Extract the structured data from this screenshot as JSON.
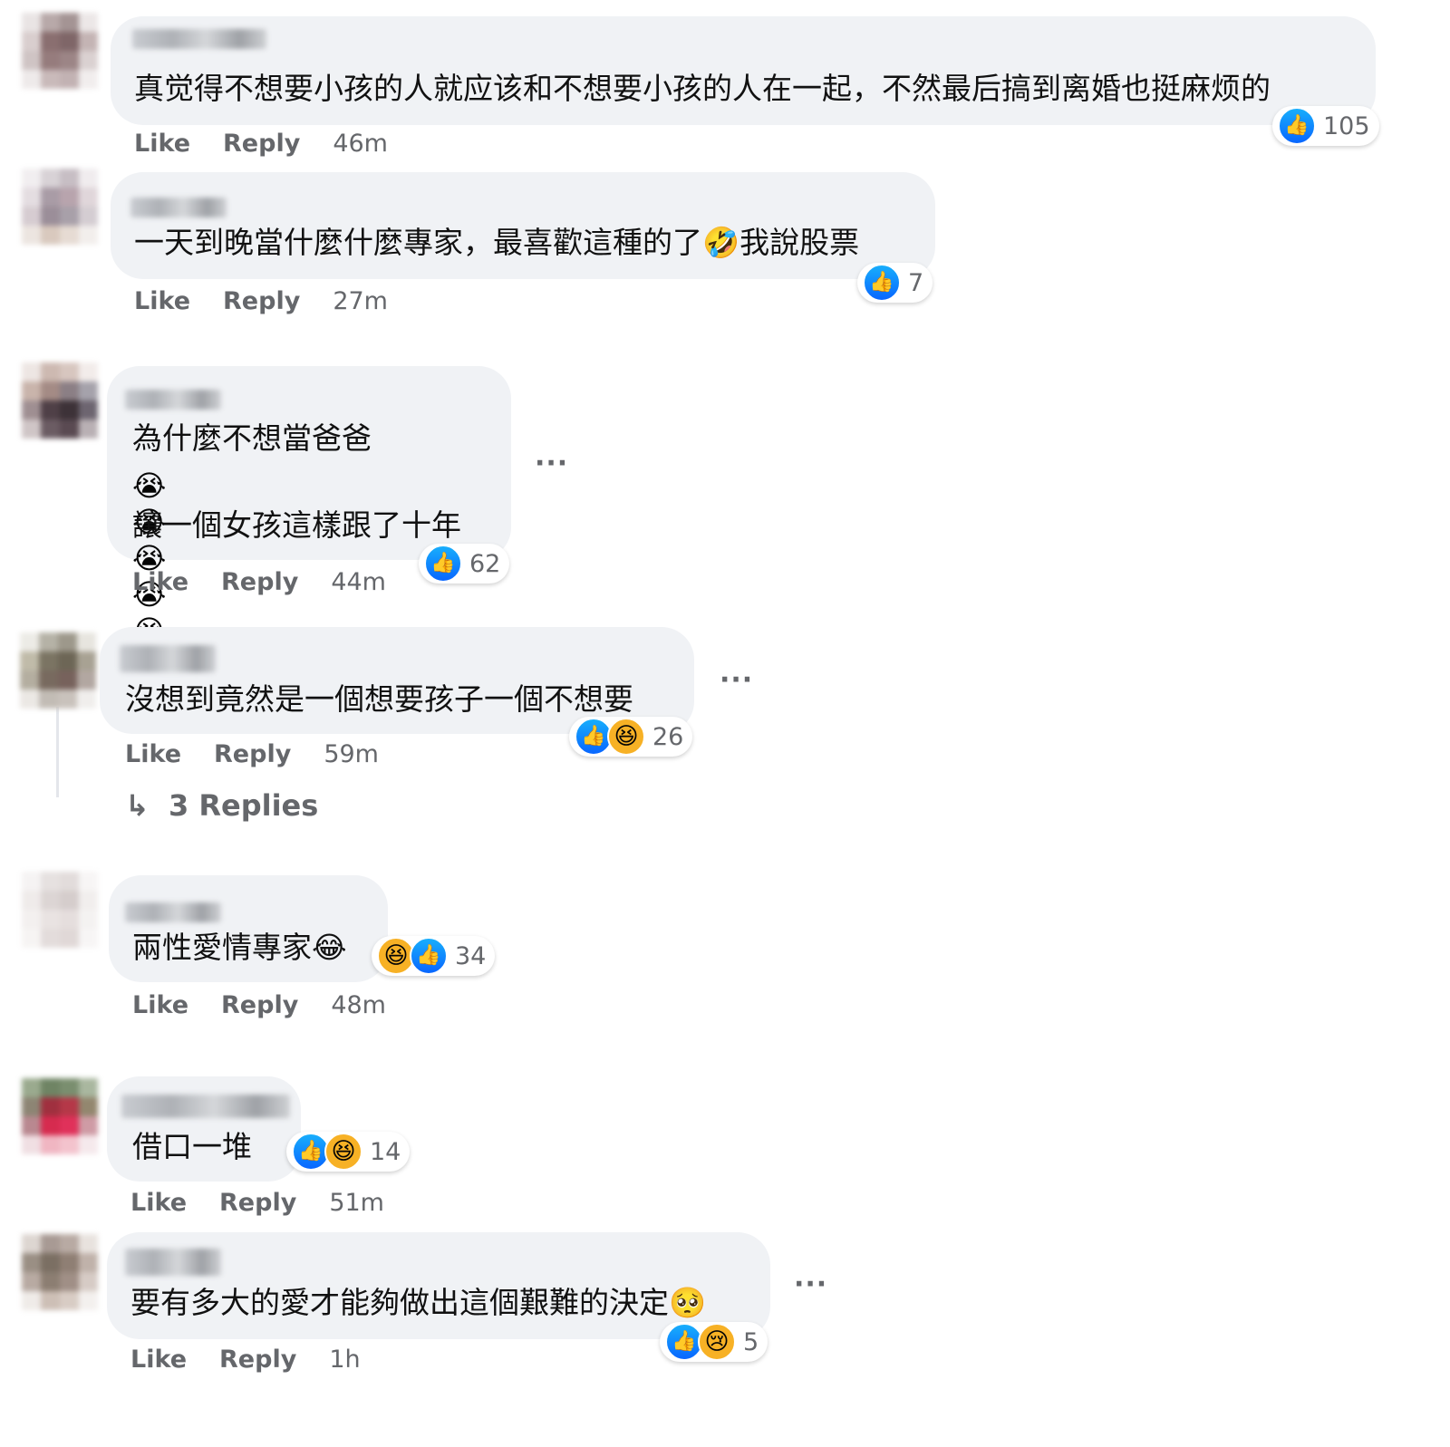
{
  "comments": [
    {
      "text_lines": [
        "真觉得不想要小孩的人就应该和不想要小孩的人在一起，不然最后搞到离婚也挺麻烦的"
      ],
      "reactions": [
        "like"
      ],
      "reaction_count": "105",
      "like": "Like",
      "reply": "Reply",
      "time": "46m"
    },
    {
      "text_lines": [
        "一天到晚當什麼什麼專家，最喜歡這種的了🤣我說股票"
      ],
      "reactions": [
        "like"
      ],
      "reaction_count": "7",
      "like": "Like",
      "reply": "Reply",
      "time": "27m"
    },
    {
      "text_lines": [
        "為什麼不想當爸爸",
        "😭😭😭😭😭😭",
        "讓一個女孩這樣跟了十年"
      ],
      "reactions": [
        "like"
      ],
      "reaction_count": "62",
      "like": "Like",
      "reply": "Reply",
      "time": "44m",
      "more": "···"
    },
    {
      "text_lines": [
        "沒想到竟然是一個想要孩子一個不想要"
      ],
      "reactions": [
        "like",
        "haha"
      ],
      "reaction_count": "26",
      "like": "Like",
      "reply": "Reply",
      "time": "59m",
      "more": "···",
      "replies_link": "3 Replies",
      "replies_arrow": "↳"
    },
    {
      "text_lines": [
        "兩性愛情專家😂"
      ],
      "reactions": [
        "haha",
        "like"
      ],
      "reaction_count": "34",
      "like": "Like",
      "reply": "Reply",
      "time": "48m"
    },
    {
      "text_lines": [
        "借口一堆"
      ],
      "reactions": [
        "like",
        "haha"
      ],
      "reaction_count": "14",
      "like": "Like",
      "reply": "Reply",
      "time": "51m"
    },
    {
      "text_lines": [
        "要有多大的愛才能夠做出這個艱難的決定🥺"
      ],
      "reactions": [
        "like",
        "sad"
      ],
      "reaction_count": "5",
      "like": "Like",
      "reply": "Reply",
      "time": "1h",
      "more": "···"
    }
  ],
  "icons": {
    "like": "thumbs-up-icon",
    "haha": "laughing-face-icon",
    "sad": "crying-face-icon",
    "more": "more-options-icon",
    "reply_arrow": "reply-arrow-icon"
  },
  "colors": {
    "bubble_bg": "#f0f2f5",
    "like_blue": "#0866ff",
    "muted_text": "#65676b",
    "haha_yellow": "#f7b125"
  }
}
